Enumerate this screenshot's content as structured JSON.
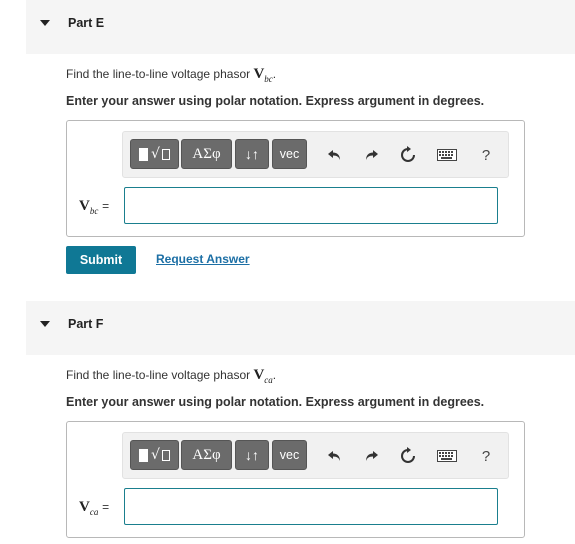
{
  "partE": {
    "title": "Part E",
    "prompt_text": "Find the line-to-line voltage phasor",
    "phasor_symbol": "V",
    "phasor_sub": "bc",
    "prompt_end": ".",
    "instruction": "Enter your answer using polar notation. Express argument in degrees.",
    "var_symbol": "V",
    "var_sub": "bc",
    "var_eq": "=",
    "answer_value": ""
  },
  "partF": {
    "title": "Part F",
    "prompt_text": "Find the line-to-line voltage phasor",
    "phasor_symbol": "V",
    "phasor_sub": "ca",
    "prompt_end": ".",
    "instruction": "Enter your answer using polar notation. Express argument in degrees.",
    "var_symbol": "V",
    "var_sub": "ca",
    "var_eq": "=",
    "answer_value": ""
  },
  "toolbar": {
    "greek_label": "ΑΣφ",
    "arrows_label": "↓↑",
    "vec_label": "vec",
    "help_label": "?"
  },
  "actions": {
    "submit_label": "Submit",
    "request_label": "Request Answer"
  },
  "colors": {
    "submit_bg": "#0f7895",
    "link": "#1c6fa5",
    "input_border": "#1a7f8e",
    "header_bg": "#f5f5f5"
  }
}
